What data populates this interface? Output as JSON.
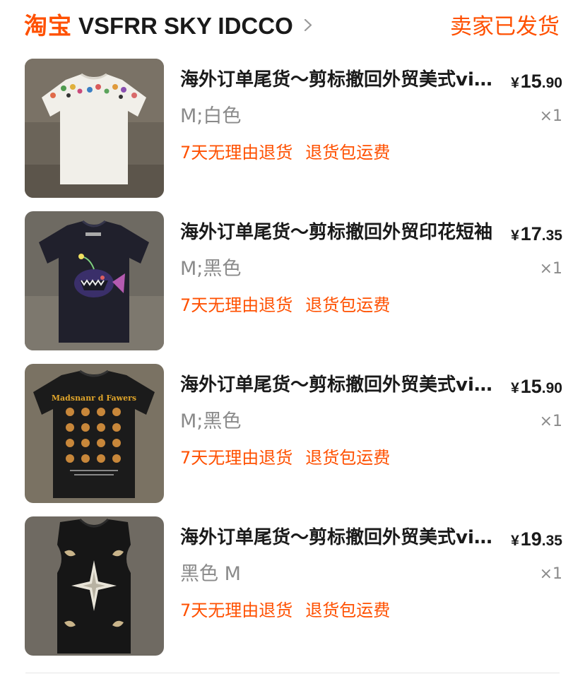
{
  "header": {
    "logo": "淘宝",
    "store_name": "VSFRR SKY IDCCO",
    "status": "卖家已发货"
  },
  "items": [
    {
      "title": "海外订单尾货～剪标撤回外贸美式vintage",
      "price_currency": "¥",
      "price_int": "15",
      "price_dec": ".90",
      "variant": "M;白色",
      "quantity": "×1",
      "tags": [
        "7天无理由退货",
        "退货包运费"
      ],
      "image_desc": "white-tshirt-embroidered-flowers"
    },
    {
      "title": "海外订单尾货～剪标撤回外贸印花短袖",
      "price_currency": "¥",
      "price_int": "17",
      "price_dec": ".35",
      "variant": "M;黑色",
      "quantity": "×1",
      "tags": [
        "7天无理由退货",
        "退货包运费"
      ],
      "image_desc": "black-tshirt-anglerfish-print"
    },
    {
      "title": "海外订单尾货～剪标撤回外贸美式vintage",
      "price_currency": "¥",
      "price_int": "15",
      "price_dec": ".90",
      "variant": "M;黑色",
      "quantity": "×1",
      "tags": [
        "7天无理由退货",
        "退货包运费"
      ],
      "image_desc": "black-tshirt-food-menu-print",
      "shirt_print_text": "Madsnanr d Fawers"
    },
    {
      "title": "海外订单尾货～剪标撤回外贸美式vintage",
      "price_currency": "¥",
      "price_int": "19",
      "price_dec": ".35",
      "variant": "黑色 M",
      "quantity": "×1",
      "tags": [
        "7天无理由退货",
        "退货包运费"
      ],
      "image_desc": "black-vest-star-print"
    }
  ],
  "colors": {
    "accent": "#ff5000",
    "text_primary": "#1a1a1a",
    "text_secondary": "#8a8a8a"
  }
}
